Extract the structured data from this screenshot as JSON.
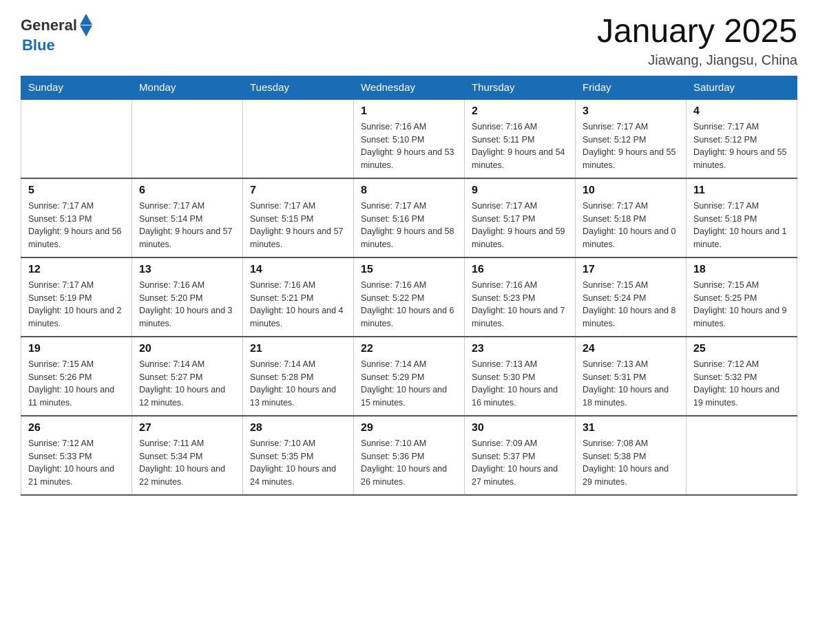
{
  "header": {
    "logo_general": "General",
    "logo_blue": "Blue",
    "title": "January 2025",
    "subtitle": "Jiawang, Jiangsu, China"
  },
  "weekdays": [
    "Sunday",
    "Monday",
    "Tuesday",
    "Wednesday",
    "Thursday",
    "Friday",
    "Saturday"
  ],
  "weeks": [
    [
      {
        "day": "",
        "sunrise": "",
        "sunset": "",
        "daylight": ""
      },
      {
        "day": "",
        "sunrise": "",
        "sunset": "",
        "daylight": ""
      },
      {
        "day": "",
        "sunrise": "",
        "sunset": "",
        "daylight": ""
      },
      {
        "day": "1",
        "sunrise": "Sunrise: 7:16 AM",
        "sunset": "Sunset: 5:10 PM",
        "daylight": "Daylight: 9 hours and 53 minutes."
      },
      {
        "day": "2",
        "sunrise": "Sunrise: 7:16 AM",
        "sunset": "Sunset: 5:11 PM",
        "daylight": "Daylight: 9 hours and 54 minutes."
      },
      {
        "day": "3",
        "sunrise": "Sunrise: 7:17 AM",
        "sunset": "Sunset: 5:12 PM",
        "daylight": "Daylight: 9 hours and 55 minutes."
      },
      {
        "day": "4",
        "sunrise": "Sunrise: 7:17 AM",
        "sunset": "Sunset: 5:12 PM",
        "daylight": "Daylight: 9 hours and 55 minutes."
      }
    ],
    [
      {
        "day": "5",
        "sunrise": "Sunrise: 7:17 AM",
        "sunset": "Sunset: 5:13 PM",
        "daylight": "Daylight: 9 hours and 56 minutes."
      },
      {
        "day": "6",
        "sunrise": "Sunrise: 7:17 AM",
        "sunset": "Sunset: 5:14 PM",
        "daylight": "Daylight: 9 hours and 57 minutes."
      },
      {
        "day": "7",
        "sunrise": "Sunrise: 7:17 AM",
        "sunset": "Sunset: 5:15 PM",
        "daylight": "Daylight: 9 hours and 57 minutes."
      },
      {
        "day": "8",
        "sunrise": "Sunrise: 7:17 AM",
        "sunset": "Sunset: 5:16 PM",
        "daylight": "Daylight: 9 hours and 58 minutes."
      },
      {
        "day": "9",
        "sunrise": "Sunrise: 7:17 AM",
        "sunset": "Sunset: 5:17 PM",
        "daylight": "Daylight: 9 hours and 59 minutes."
      },
      {
        "day": "10",
        "sunrise": "Sunrise: 7:17 AM",
        "sunset": "Sunset: 5:18 PM",
        "daylight": "Daylight: 10 hours and 0 minutes."
      },
      {
        "day": "11",
        "sunrise": "Sunrise: 7:17 AM",
        "sunset": "Sunset: 5:18 PM",
        "daylight": "Daylight: 10 hours and 1 minute."
      }
    ],
    [
      {
        "day": "12",
        "sunrise": "Sunrise: 7:17 AM",
        "sunset": "Sunset: 5:19 PM",
        "daylight": "Daylight: 10 hours and 2 minutes."
      },
      {
        "day": "13",
        "sunrise": "Sunrise: 7:16 AM",
        "sunset": "Sunset: 5:20 PM",
        "daylight": "Daylight: 10 hours and 3 minutes."
      },
      {
        "day": "14",
        "sunrise": "Sunrise: 7:16 AM",
        "sunset": "Sunset: 5:21 PM",
        "daylight": "Daylight: 10 hours and 4 minutes."
      },
      {
        "day": "15",
        "sunrise": "Sunrise: 7:16 AM",
        "sunset": "Sunset: 5:22 PM",
        "daylight": "Daylight: 10 hours and 6 minutes."
      },
      {
        "day": "16",
        "sunrise": "Sunrise: 7:16 AM",
        "sunset": "Sunset: 5:23 PM",
        "daylight": "Daylight: 10 hours and 7 minutes."
      },
      {
        "day": "17",
        "sunrise": "Sunrise: 7:15 AM",
        "sunset": "Sunset: 5:24 PM",
        "daylight": "Daylight: 10 hours and 8 minutes."
      },
      {
        "day": "18",
        "sunrise": "Sunrise: 7:15 AM",
        "sunset": "Sunset: 5:25 PM",
        "daylight": "Daylight: 10 hours and 9 minutes."
      }
    ],
    [
      {
        "day": "19",
        "sunrise": "Sunrise: 7:15 AM",
        "sunset": "Sunset: 5:26 PM",
        "daylight": "Daylight: 10 hours and 11 minutes."
      },
      {
        "day": "20",
        "sunrise": "Sunrise: 7:14 AM",
        "sunset": "Sunset: 5:27 PM",
        "daylight": "Daylight: 10 hours and 12 minutes."
      },
      {
        "day": "21",
        "sunrise": "Sunrise: 7:14 AM",
        "sunset": "Sunset: 5:28 PM",
        "daylight": "Daylight: 10 hours and 13 minutes."
      },
      {
        "day": "22",
        "sunrise": "Sunrise: 7:14 AM",
        "sunset": "Sunset: 5:29 PM",
        "daylight": "Daylight: 10 hours and 15 minutes."
      },
      {
        "day": "23",
        "sunrise": "Sunrise: 7:13 AM",
        "sunset": "Sunset: 5:30 PM",
        "daylight": "Daylight: 10 hours and 16 minutes."
      },
      {
        "day": "24",
        "sunrise": "Sunrise: 7:13 AM",
        "sunset": "Sunset: 5:31 PM",
        "daylight": "Daylight: 10 hours and 18 minutes."
      },
      {
        "day": "25",
        "sunrise": "Sunrise: 7:12 AM",
        "sunset": "Sunset: 5:32 PM",
        "daylight": "Daylight: 10 hours and 19 minutes."
      }
    ],
    [
      {
        "day": "26",
        "sunrise": "Sunrise: 7:12 AM",
        "sunset": "Sunset: 5:33 PM",
        "daylight": "Daylight: 10 hours and 21 minutes."
      },
      {
        "day": "27",
        "sunrise": "Sunrise: 7:11 AM",
        "sunset": "Sunset: 5:34 PM",
        "daylight": "Daylight: 10 hours and 22 minutes."
      },
      {
        "day": "28",
        "sunrise": "Sunrise: 7:10 AM",
        "sunset": "Sunset: 5:35 PM",
        "daylight": "Daylight: 10 hours and 24 minutes."
      },
      {
        "day": "29",
        "sunrise": "Sunrise: 7:10 AM",
        "sunset": "Sunset: 5:36 PM",
        "daylight": "Daylight: 10 hours and 26 minutes."
      },
      {
        "day": "30",
        "sunrise": "Sunrise: 7:09 AM",
        "sunset": "Sunset: 5:37 PM",
        "daylight": "Daylight: 10 hours and 27 minutes."
      },
      {
        "day": "31",
        "sunrise": "Sunrise: 7:08 AM",
        "sunset": "Sunset: 5:38 PM",
        "daylight": "Daylight: 10 hours and 29 minutes."
      },
      {
        "day": "",
        "sunrise": "",
        "sunset": "",
        "daylight": ""
      }
    ]
  ]
}
